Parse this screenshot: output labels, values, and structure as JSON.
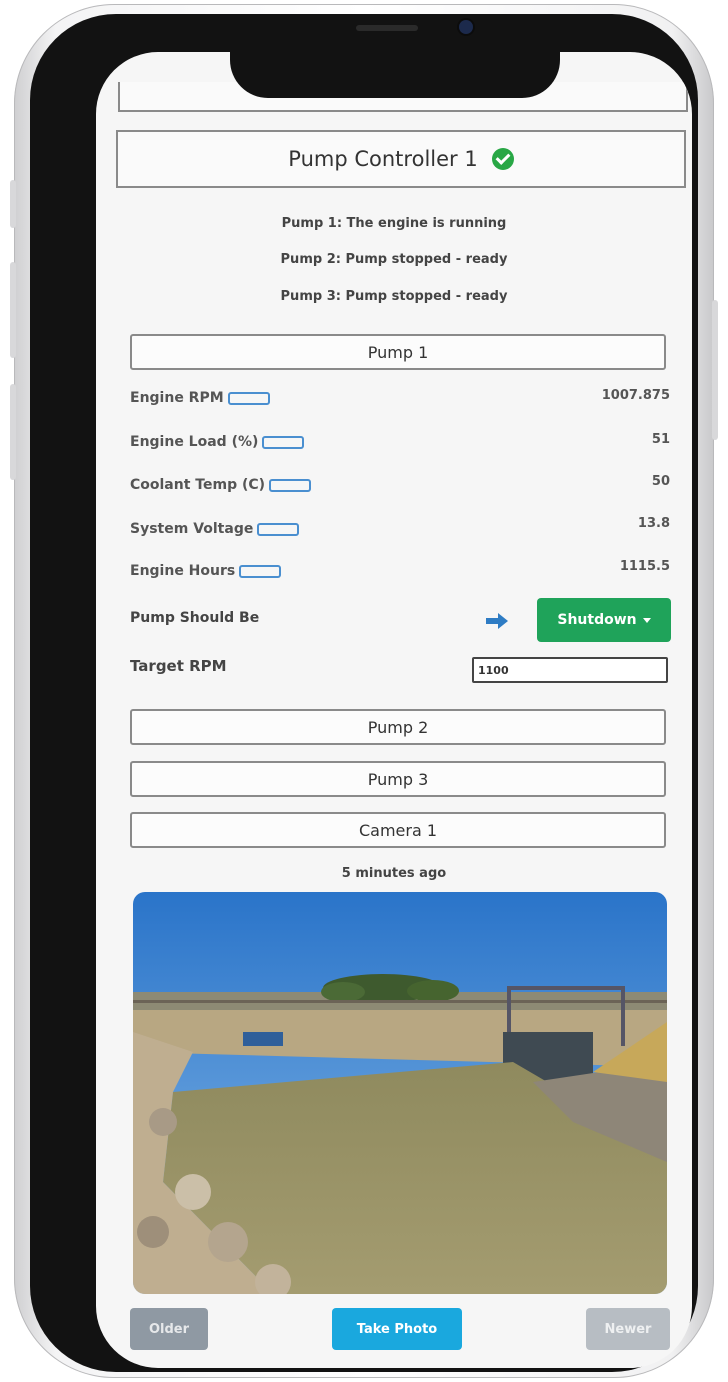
{
  "controller": {
    "title": "Pump Controller 1",
    "status_icon": "check-circle-icon",
    "status_color": "#28a745"
  },
  "status_lines": [
    "Pump 1: The engine is running",
    "Pump 2: Pump stopped - ready",
    "Pump 3: Pump stopped - ready"
  ],
  "pump1": {
    "header": "Pump 1",
    "metrics": [
      {
        "label": "Engine RPM",
        "value": "1007.875"
      },
      {
        "label": "Engine Load (%)",
        "value": "51"
      },
      {
        "label": "Coolant Temp (C)",
        "value": "50"
      },
      {
        "label": "System Voltage",
        "value": "13.8"
      },
      {
        "label": "Engine Hours",
        "value": "1115.5"
      }
    ],
    "should_be_label": "Pump Should Be",
    "should_be_value": "Shutdown",
    "target_label": "Target RPM",
    "target_value": "1100"
  },
  "sections": {
    "pump2": "Pump 2",
    "pump3": "Pump 3",
    "camera1": "Camera 1"
  },
  "camera": {
    "timestamp": "5 minutes ago"
  },
  "buttons": {
    "older": "Older",
    "take_photo": "Take Photo",
    "newer": "Newer"
  },
  "colors": {
    "accent_green": "#1fa35a",
    "accent_blue": "#1aa8de",
    "arrow_blue": "#2e7cc4"
  }
}
